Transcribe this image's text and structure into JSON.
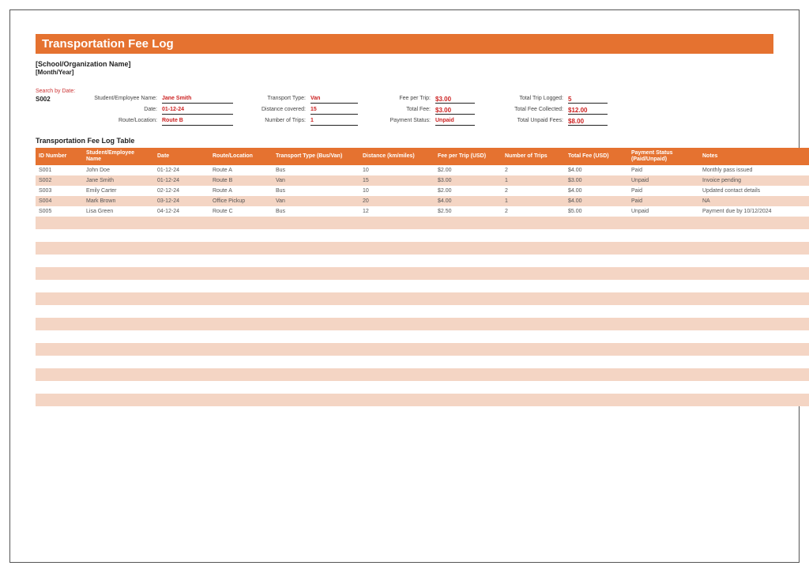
{
  "title": "Transportation Fee Log",
  "org_name": "[School/Organization Name]",
  "month_year": "[Month/Year]",
  "search_label": "Search by Date:",
  "search_id": "S002",
  "summary": {
    "student_label": "Student/Employee Name:",
    "student_value": "Jane Smith",
    "date_label": "Date:",
    "date_value": "01-12-24",
    "route_label": "Route/Location:",
    "route_value": "Route B",
    "type_label": "Transport Type:",
    "type_value": "Van",
    "distance_label": "Distance covered:",
    "distance_value": "15",
    "trips_label": "Number of Trips:",
    "trips_value": "1",
    "feepertrip_label": "Fee per Trip:",
    "feepertrip_value": "$3.00",
    "totalfee_label": "Total Fee:",
    "totalfee_value": "$3.00",
    "status_label": "Payment Status:",
    "status_value": "Unpaid",
    "totaltrip_label": "Total Trip Logged:",
    "totaltrip_value": "5",
    "totalcollected_label": "Total Fee Collected:",
    "totalcollected_value": "$12.00",
    "totalunpaid_label": "Total Unpaid Fees:",
    "totalunpaid_value": "$8.00"
  },
  "table_title": "Transportation Fee Log Table",
  "columns": {
    "id": "ID Number",
    "name": "Student/Employee Name",
    "date": "Date",
    "route": "Route/Location",
    "type": "Transport Type (Bus/Van)",
    "distance": "Distance (km/miles)",
    "fee": "Fee per Trip (USD)",
    "trips": "Number of Trips",
    "total": "Total Fee (USD)",
    "status": "Payment Status (Paid/Unpaid)",
    "notes": "Notes"
  },
  "rows": [
    {
      "id": "S001",
      "name": "John Doe",
      "date": "01-12-24",
      "route": "Route A",
      "type": "Bus",
      "distance": "10",
      "fee": "$2.00",
      "trips": "2",
      "total": "$4.00",
      "status": "Paid",
      "notes": "Monthly pass issued"
    },
    {
      "id": "S002",
      "name": "Jane Smith",
      "date": "01-12-24",
      "route": "Route B",
      "type": "Van",
      "distance": "15",
      "fee": "$3.00",
      "trips": "1",
      "total": "$3.00",
      "status": "Unpaid",
      "notes": "Invoice pending"
    },
    {
      "id": "S003",
      "name": "Emily Carter",
      "date": "02-12-24",
      "route": "Route A",
      "type": "Bus",
      "distance": "10",
      "fee": "$2.00",
      "trips": "2",
      "total": "$4.00",
      "status": "Paid",
      "notes": "Updated contact details"
    },
    {
      "id": "S004",
      "name": "Mark Brown",
      "date": "03-12-24",
      "route": "Office Pickup",
      "type": "Van",
      "distance": "20",
      "fee": "$4.00",
      "trips": "1",
      "total": "$4.00",
      "status": "Paid",
      "notes": "NA"
    },
    {
      "id": "S005",
      "name": "Lisa Green",
      "date": "04-12-24",
      "route": "Route C",
      "type": "Bus",
      "distance": "12",
      "fee": "$2.50",
      "trips": "2",
      "total": "$5.00",
      "status": "Unpaid",
      "notes": "Payment due by 10/12/2024"
    }
  ],
  "blank_rows": 15
}
